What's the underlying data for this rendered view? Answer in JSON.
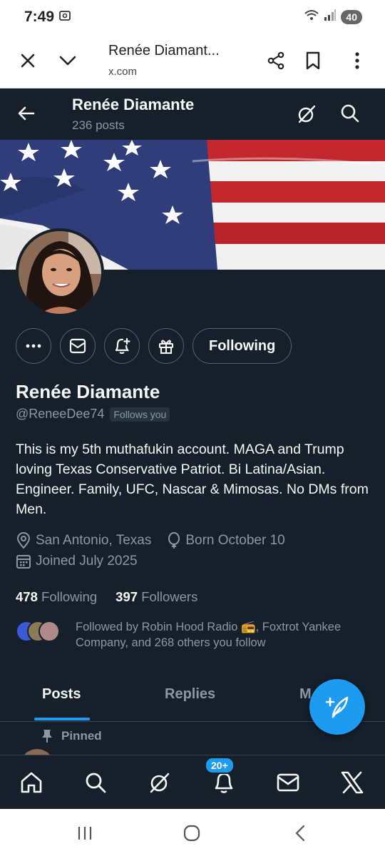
{
  "status_bar": {
    "time": "7:49",
    "battery": "40"
  },
  "browser": {
    "page_title": "Renée Diamant...",
    "url": "x.com",
    "icons": [
      "close-icon",
      "chevron-down-icon",
      "share-icon",
      "bookmark-icon",
      "more-vert-icon"
    ]
  },
  "profile_header": {
    "name": "Renée Diamante",
    "post_count": "236 posts"
  },
  "profile": {
    "name": "Renée Diamante",
    "handle": "@ReneeDee74",
    "follows_you": "Follows you",
    "following_button": "Following",
    "bio": "This is my 5th muthafukin account. MAGA and Trump loving Texas Conservative Patriot. Bi Latina/Asian. Engineer. Family, UFC, Nascar & Mimosas. No DMs from Men.",
    "location": "San Antonio, Texas",
    "birthday": "Born October 10",
    "joined": "Joined July 2025",
    "following_count": "478",
    "following_label": "Following",
    "followers_count": "397",
    "followers_label": "Followers",
    "followed_by": "Followed by Robin Hood Radio 📻, Foxtrot Yankee Company, and 268 others you follow"
  },
  "tabs": [
    {
      "label": "Posts",
      "active": true
    },
    {
      "label": "Replies",
      "active": false
    },
    {
      "label": "M",
      "active": false
    }
  ],
  "pinned": {
    "label": "Pinned"
  },
  "bottom_nav": {
    "items": [
      "home-icon",
      "search-icon",
      "grok-icon",
      "notifications-icon",
      "messages-icon",
      "x-logo-icon"
    ],
    "notification_badge": "20+"
  },
  "colors": {
    "background": "#15202b",
    "accent": "#1d9bf0",
    "secondary_text": "#8b98a5"
  }
}
